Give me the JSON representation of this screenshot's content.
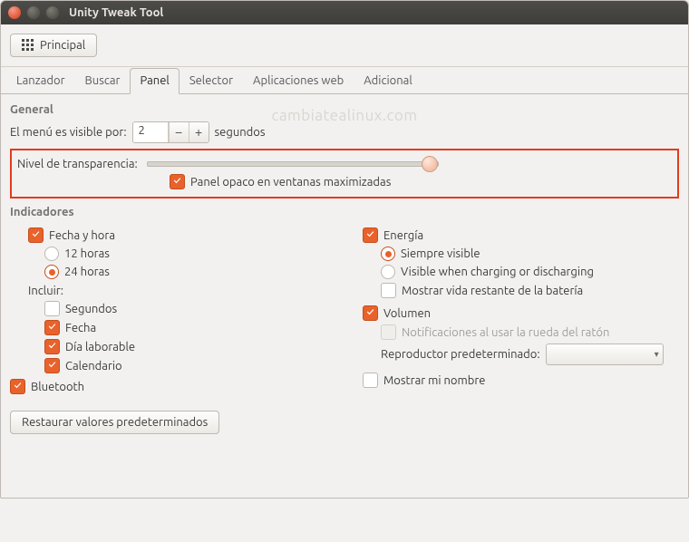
{
  "window": {
    "title": "Unity Tweak Tool"
  },
  "toolbar": {
    "principal_label": "Principal"
  },
  "tabs": [
    {
      "label": "Lanzador",
      "active": false
    },
    {
      "label": "Buscar",
      "active": false
    },
    {
      "label": "Panel",
      "active": true
    },
    {
      "label": "Selector",
      "active": false
    },
    {
      "label": "Aplicaciones web",
      "active": false
    },
    {
      "label": "Adicional",
      "active": false
    }
  ],
  "watermark": "cambiatealinux.com",
  "general": {
    "title": "General",
    "menu_visible_label": "El menú es visible por:",
    "menu_visible_value": "2",
    "menu_visible_unit": "segundos",
    "transparency_label": "Nivel de transparencia:",
    "opaque_panel_label": "Panel opaco en ventanas maximizadas"
  },
  "indicators": {
    "title": "Indicadores",
    "datetime_label": "Fecha y hora",
    "radio_12h": "12 horas",
    "radio_24h": "24 horas",
    "include_label": "Incluir:",
    "seconds": "Segundos",
    "date": "Fecha",
    "workday": "Día laborable",
    "calendar": "Calendario",
    "bluetooth": "Bluetooth",
    "energy_label": "Energía",
    "energy_always": "Siempre visible",
    "energy_charging": "Visible when charging or discharging",
    "energy_remaining": "Mostrar vida restante de la batería",
    "volume_label": "Volumen",
    "volume_notify": "Notificaciones al usar la rueda del ratón",
    "player_label": "Reproductor predeterminado:",
    "show_name": "Mostrar mi nombre"
  },
  "restore_button": "Restaurar valores predeterminados"
}
